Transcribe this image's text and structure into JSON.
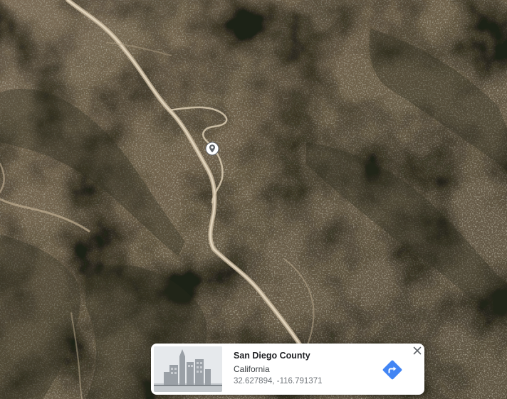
{
  "map": {
    "type": "satellite",
    "pin_icon": "map-pin-icon"
  },
  "info_card": {
    "title": "San Diego County",
    "subtitle": "California",
    "coordinates": "32.627894, -116.791371",
    "thumbnail_icon": "city-buildings-icon",
    "directions_icon": "directions-icon",
    "close_icon": "close-icon",
    "accent_color": "#4285f4"
  }
}
